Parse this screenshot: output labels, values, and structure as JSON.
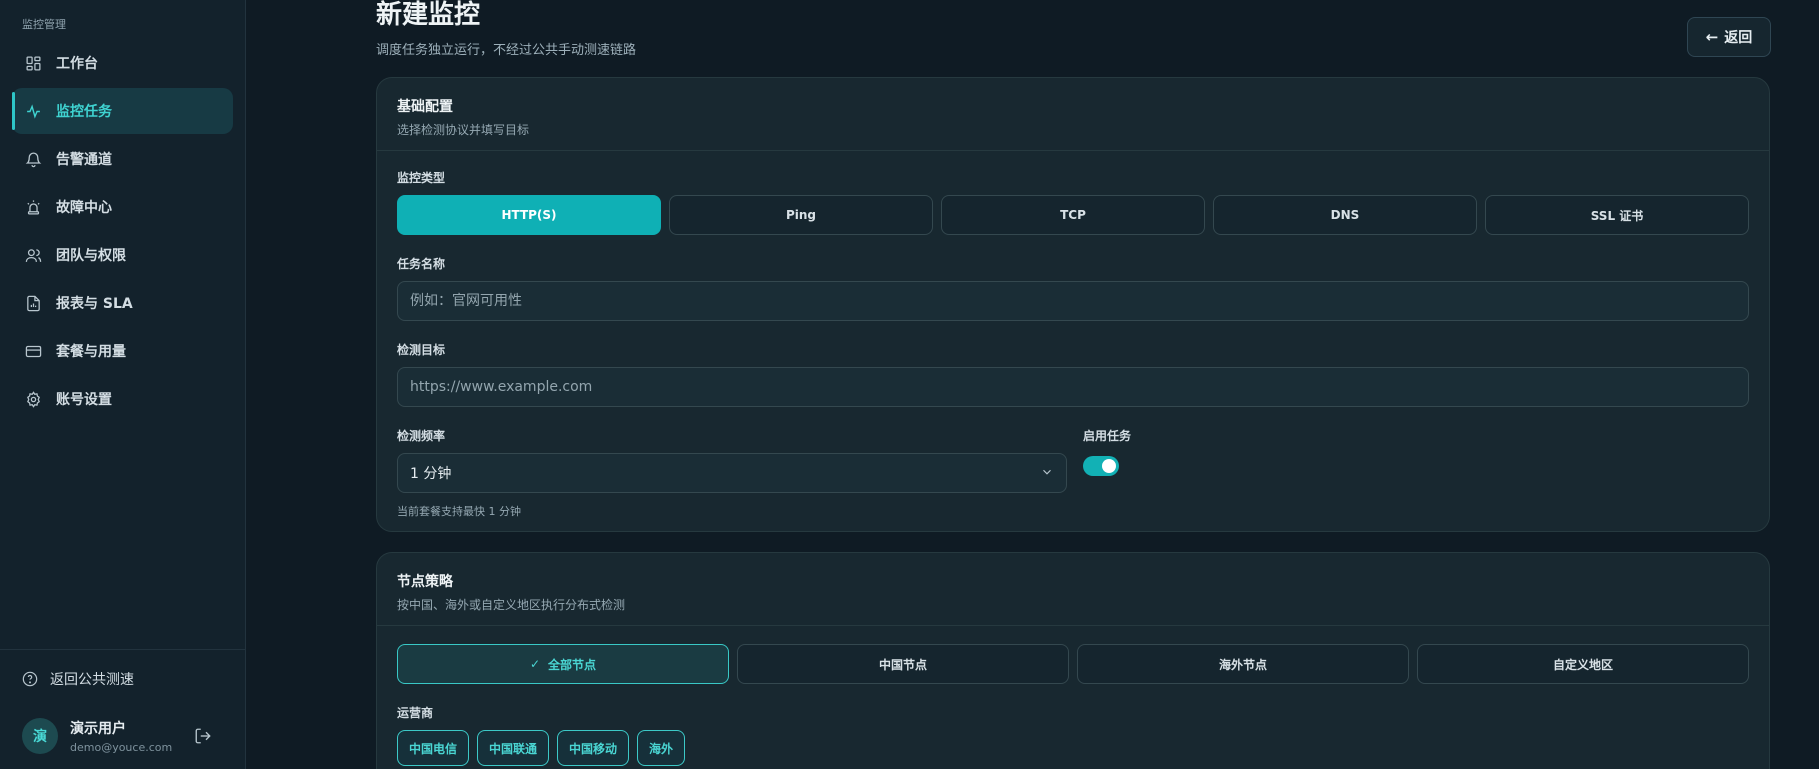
{
  "sidebar": {
    "section_label": "监控管理",
    "items": [
      {
        "label": "工作台",
        "icon": "dashboard-icon",
        "active": false
      },
      {
        "label": "监控任务",
        "icon": "activity-icon",
        "active": true
      },
      {
        "label": "告警通道",
        "icon": "bell-icon",
        "active": false
      },
      {
        "label": "故障中心",
        "icon": "siren-icon",
        "active": false
      },
      {
        "label": "团队与权限",
        "icon": "users-icon",
        "active": false
      },
      {
        "label": "报表与 SLA",
        "icon": "report-icon",
        "active": false
      },
      {
        "label": "套餐与用量",
        "icon": "credit-card-icon",
        "active": false
      },
      {
        "label": "账号设置",
        "icon": "gear-icon",
        "active": false
      }
    ],
    "back_public": "返回公共测速",
    "user": {
      "avatar_text": "演",
      "name": "演示用户",
      "email": "demo@youce.com"
    }
  },
  "header": {
    "title": "新建监控",
    "subtitle": "调度任务独立运行，不经过公共手动测速链路",
    "back_label": "返回"
  },
  "basic": {
    "title": "基础配置",
    "desc": "选择检测协议并填写目标",
    "type_label": "监控类型",
    "types": [
      "HTTP(S)",
      "Ping",
      "TCP",
      "DNS",
      "SSL 证书"
    ],
    "name_label": "任务名称",
    "name_placeholder": "例如：官网可用性",
    "target_label": "检测目标",
    "target_placeholder": "https://www.example.com",
    "freq_label": "检测频率",
    "freq_value": "1 分钟",
    "freq_hint": "当前套餐支持最快 1 分钟",
    "enable_label": "启用任务"
  },
  "nodes": {
    "title": "节点策略",
    "desc": "按中国、海外或自定义地区执行分布式检测",
    "options": [
      "全部节点",
      "中国节点",
      "海外节点",
      "自定义地区"
    ],
    "isp_label": "运营商",
    "isps": [
      "中国电信",
      "中国联通",
      "中国移动",
      "海外"
    ]
  },
  "colors": {
    "accent": "#0fb0b5",
    "accent_text": "#3fd3d1",
    "background": "#0f1b24",
    "card": "#182830"
  }
}
